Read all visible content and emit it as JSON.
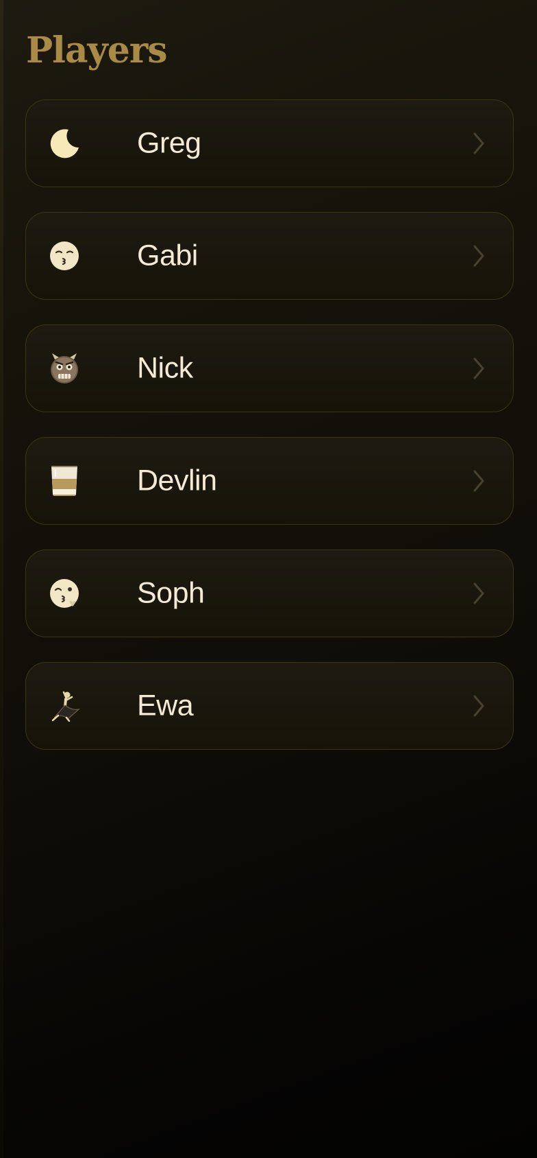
{
  "header": {
    "title": "Players"
  },
  "players": [
    {
      "name": "Greg",
      "icon": "crescent-moon-icon"
    },
    {
      "name": "Gabi",
      "icon": "kissing-face-icon"
    },
    {
      "name": "Nick",
      "icon": "ogre-mask-icon"
    },
    {
      "name": "Devlin",
      "icon": "tumbler-glass-icon"
    },
    {
      "name": "Soph",
      "icon": "face-blowing-kiss-icon"
    },
    {
      "name": "Ewa",
      "icon": "dancer-icon"
    }
  ],
  "colors": {
    "accent": "#a98a46",
    "text": "#f4ead6",
    "card_border": "#3b3417",
    "background": "#15120a"
  }
}
